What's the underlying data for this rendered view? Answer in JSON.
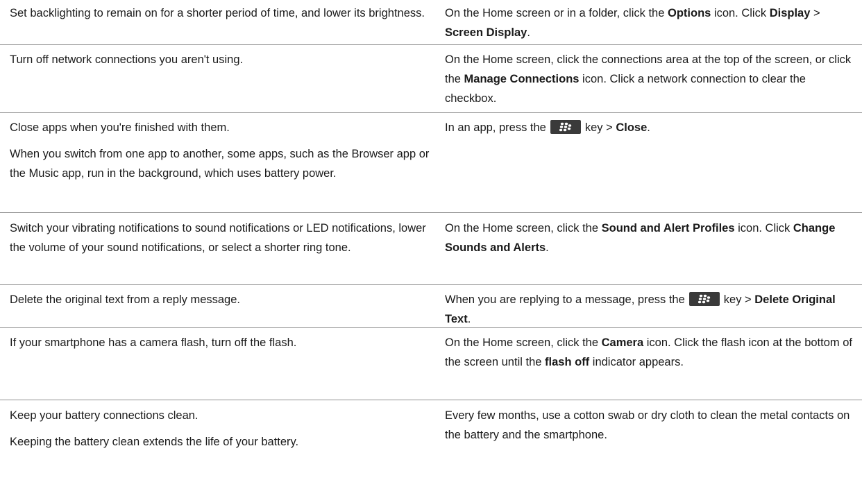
{
  "icons": {
    "menu_key": "blackberry-menu-key-icon"
  },
  "rows": [
    {
      "tip": [
        "Set backlighting to remain on for a shorter period of time, and lower its brightness."
      ],
      "how": {
        "t1": "On the Home screen or in a folder, click the ",
        "b1": "Options",
        "t2": " icon. Click ",
        "b2": "Display",
        "t3": " > ",
        "b3": "Screen Display",
        "t4": "."
      }
    },
    {
      "tip": [
        "Turn off network connections you aren't using."
      ],
      "how": {
        "t1": "On the Home screen, click the connections area at the top of the screen, or click the ",
        "b1": "Manage Connections",
        "t2": " icon. Click a network connection to clear the checkbox."
      }
    },
    {
      "tip": [
        "Close apps when you're finished with them.",
        "When you switch from one app to another, some apps, such as the Browser app or the Music app, run in the background, which uses battery power."
      ],
      "how": {
        "t1": "In an app, press the",
        "t2": "key > ",
        "b1": "Close",
        "t3": "."
      }
    },
    {
      "tip": [
        "Switch your vibrating notifications to sound notifications or LED notifications, lower the volume of your sound notifications, or select a shorter ring tone."
      ],
      "how": {
        "t1": "On the Home screen, click the ",
        "b1": "Sound and Alert Profiles",
        "t2": " icon. Click ",
        "b2": "Change Sounds and Alerts",
        "t3": "."
      }
    },
    {
      "tip": [
        "Delete the original text from a reply message."
      ],
      "how": {
        "t1": "When you are replying to a message, press the",
        "t2": "key > ",
        "b1": "Delete Original Text",
        "t3": "."
      }
    },
    {
      "tip": [
        "If your smartphone has a camera flash, turn off the flash."
      ],
      "how": {
        "t1": "On the Home screen, click the ",
        "b1": "Camera",
        "t2": " icon. Click the flash icon at the bottom of the screen until the ",
        "b2": "flash off",
        "t3": " indicator appears."
      }
    },
    {
      "tip": [
        "Keep your battery connections clean.",
        "Keeping the battery clean extends the life of your battery."
      ],
      "how": {
        "t1": "Every few months, use a cotton swab or dry cloth to clean the metal contacts on the battery and the smartphone."
      }
    }
  ]
}
